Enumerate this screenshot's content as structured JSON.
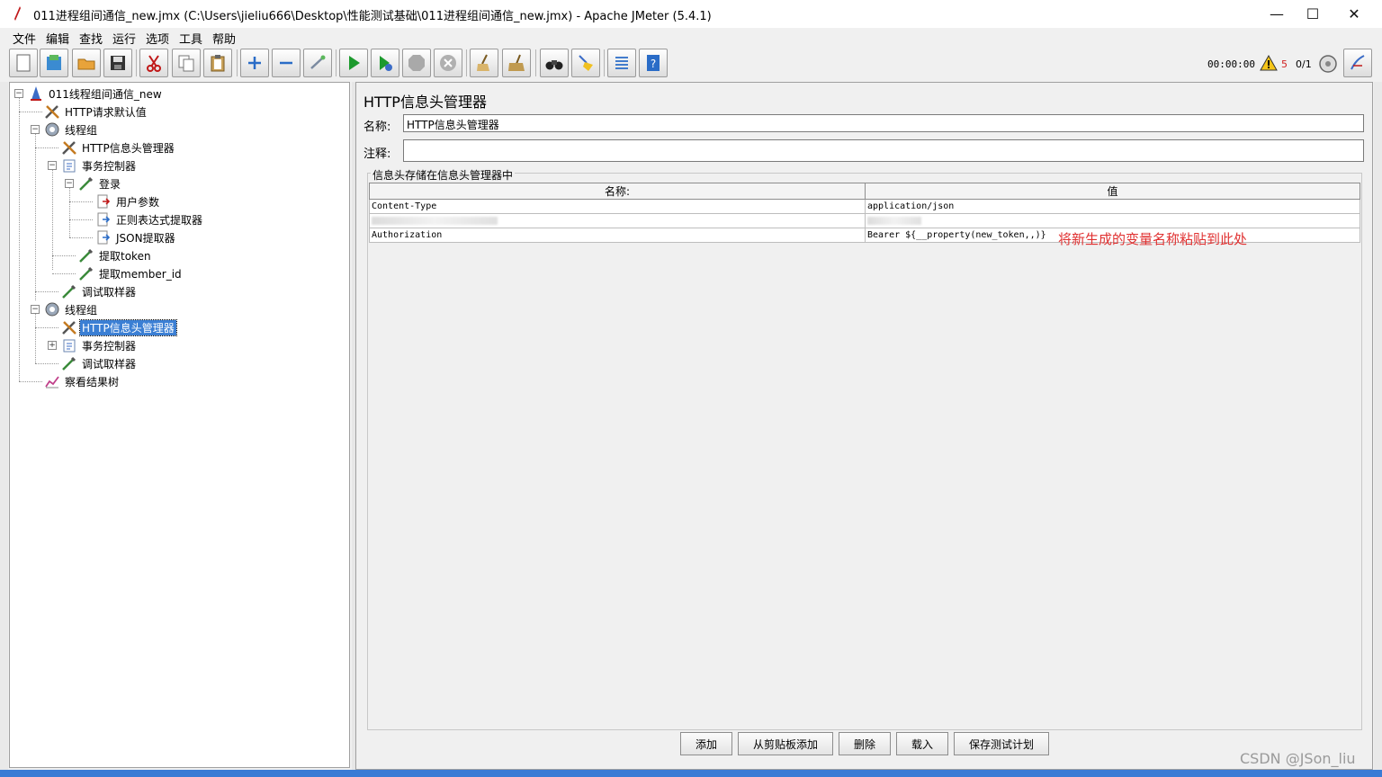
{
  "window": {
    "title": "011进程组间通信_new.jmx (C:\\Users\\jieliu666\\Desktop\\性能测试基础\\011进程组间通信_new.jmx) - Apache JMeter (5.4.1)",
    "minimize": "—",
    "maximize": "☐",
    "close": "✕"
  },
  "menu": [
    "文件",
    "编辑",
    "查找",
    "运行",
    "选项",
    "工具",
    "帮助"
  ],
  "status": {
    "time": "00:00:00",
    "warnings": "5",
    "threads": "0/1"
  },
  "tree": [
    {
      "label": "011线程组间通信_new",
      "icon": "test-plan-icon"
    },
    {
      "label": "HTTP请求默认值",
      "icon": "config-tools-icon"
    },
    {
      "label": "线程组",
      "icon": "thread-group-gear-icon"
    },
    {
      "label": "HTTP信息头管理器",
      "icon": "config-tools-icon"
    },
    {
      "label": "事务控制器",
      "icon": "controller-icon"
    },
    {
      "label": "登录",
      "icon": "sampler-pipette-icon"
    },
    {
      "label": "用户参数",
      "icon": "preprocessor-icon"
    },
    {
      "label": "正则表达式提取器",
      "icon": "postprocessor-icon"
    },
    {
      "label": "JSON提取器",
      "icon": "postprocessor-icon"
    },
    {
      "label": "提取token",
      "icon": "sampler-pipette-icon"
    },
    {
      "label": "提取member_id",
      "icon": "sampler-pipette-icon"
    },
    {
      "label": "调试取样器",
      "icon": "sampler-pipette-icon"
    },
    {
      "label": "线程组",
      "icon": "thread-group-gear-icon"
    },
    {
      "label": "HTTP信息头管理器",
      "icon": "config-tools-icon",
      "selected": true
    },
    {
      "label": "事务控制器",
      "icon": "controller-icon"
    },
    {
      "label": "调试取样器",
      "icon": "sampler-pipette-icon"
    },
    {
      "label": "察看结果树",
      "icon": "listener-graph-icon"
    }
  ],
  "panel": {
    "title": "HTTP信息头管理器",
    "name_label": "名称:",
    "name_value": "HTTP信息头管理器",
    "comment_label": "注释:",
    "comment_value": "",
    "group_title": "信息头存储在信息头管理器中",
    "columns": [
      "名称:",
      "值"
    ],
    "rows": [
      {
        "name": "Content-Type",
        "value": "application/json"
      },
      {
        "name": "",
        "value": ""
      },
      {
        "name": "Authorization",
        "value": "Bearer ${__property(new_token,,)}"
      }
    ],
    "annotation": "将新生成的变量名称粘贴到此处",
    "buttons": [
      "添加",
      "从剪贴板添加",
      "删除",
      "载入",
      "保存测试计划"
    ]
  },
  "watermark": "CSDN @JSon_liu"
}
